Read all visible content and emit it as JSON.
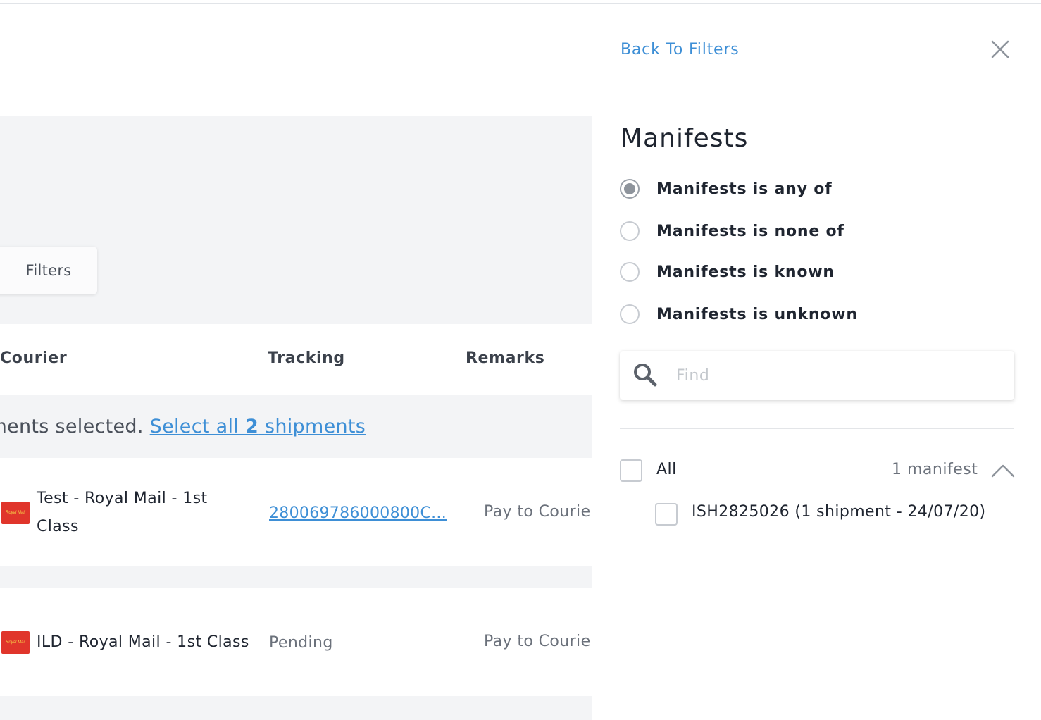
{
  "main": {
    "filters_button": "Filters",
    "columns": {
      "courier": "Courier",
      "tracking": "Tracking",
      "remarks": "Remarks"
    },
    "selection_bar": {
      "prefix": "pments selected.",
      "link_before": "Select all",
      "link_count": "2",
      "link_after": "shipments"
    },
    "rows": [
      {
        "courier": "Test - Royal Mail - 1st Class",
        "courier_line1": "Test - Royal Mail - 1st",
        "courier_line2": "Class",
        "logo_text": "Royal Mail",
        "tracking": "280069786000800C...",
        "remarks": "Pay to Courie"
      },
      {
        "courier": "ILD - Royal Mail - 1st Class",
        "logo_text": "Royal Mail",
        "tracking": "Pending",
        "remarks": "Pay to Courie"
      }
    ]
  },
  "panel": {
    "back_link": "Back To Filters",
    "title": "Manifests",
    "options": [
      {
        "label": "Manifests is any of",
        "selected": true
      },
      {
        "label": "Manifests is none of",
        "selected": false
      },
      {
        "label": "Manifests is known",
        "selected": false
      },
      {
        "label": "Manifests is unknown",
        "selected": false
      }
    ],
    "search": {
      "placeholder": "Find",
      "value": ""
    },
    "all_label": "All",
    "count_label": "1 manifest",
    "items": [
      {
        "label": "ISH2825026 (1 shipment - 24/07/20)",
        "checked": false
      }
    ]
  },
  "colors": {
    "accent": "#3e8fd6",
    "royal_mail_red": "#e0352b",
    "background_gray": "#f3f4f6"
  },
  "icons": [
    "close-icon",
    "search-icon",
    "chevron-up-icon",
    "royal-mail-logo"
  ]
}
